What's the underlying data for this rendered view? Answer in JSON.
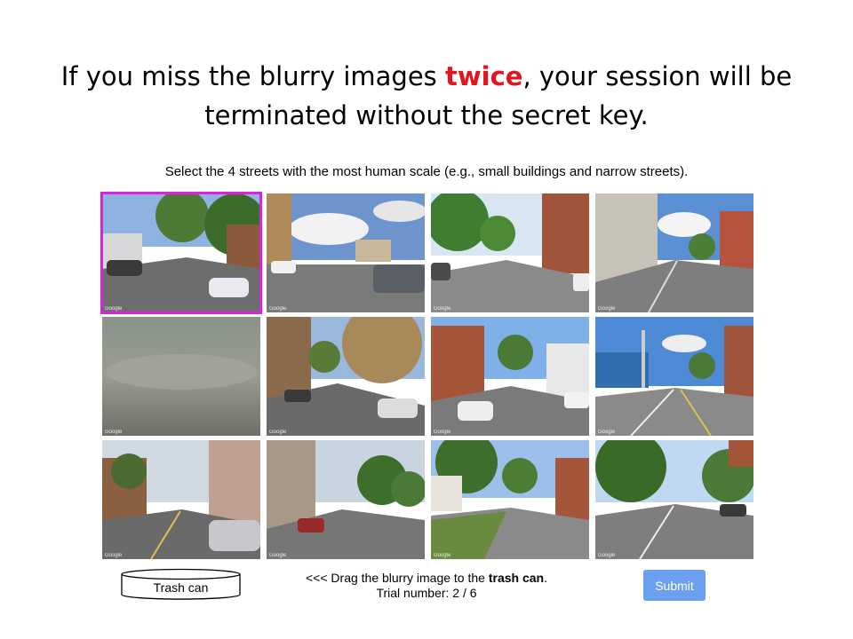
{
  "headline": {
    "before": "If you miss the blurry images ",
    "emphasis": "twice",
    "after": ", your session will be terminated without the secret key.",
    "emphasis_color": "#e3141b"
  },
  "instruction": "Select the 4 streets with the most human scale (e.g., small buildings and narrow streets).",
  "tiles": [
    {
      "name": "street-image-1",
      "selected": true,
      "blurry": false,
      "watermark": "Google"
    },
    {
      "name": "street-image-2",
      "selected": false,
      "blurry": false,
      "watermark": "Google"
    },
    {
      "name": "street-image-3",
      "selected": false,
      "blurry": false,
      "watermark": "Google"
    },
    {
      "name": "street-image-4",
      "selected": false,
      "blurry": false,
      "watermark": "Google"
    },
    {
      "name": "blurry-image",
      "selected": false,
      "blurry": true,
      "watermark": "Google"
    },
    {
      "name": "street-image-6",
      "selected": false,
      "blurry": false,
      "watermark": "Google"
    },
    {
      "name": "street-image-7",
      "selected": false,
      "blurry": false,
      "watermark": "Google"
    },
    {
      "name": "street-image-8",
      "selected": false,
      "blurry": false,
      "watermark": "Google"
    },
    {
      "name": "street-image-9",
      "selected": false,
      "blurry": false,
      "watermark": "Google"
    },
    {
      "name": "street-image-10",
      "selected": false,
      "blurry": false,
      "watermark": "Google"
    },
    {
      "name": "street-image-11",
      "selected": false,
      "blurry": false,
      "watermark": "Google"
    },
    {
      "name": "street-image-12",
      "selected": false,
      "blurry": false,
      "watermark": "Google"
    }
  ],
  "selection_color": "#dd22dd",
  "trash": {
    "label": "Trash can"
  },
  "footer": {
    "drag_prefix": "<<< Drag the blurry image to the ",
    "drag_bold": "trash can",
    "drag_suffix": ".",
    "trial": "Trial number: 2 / 6"
  },
  "submit": {
    "label": "Submit",
    "color": "#6b9ff0"
  }
}
